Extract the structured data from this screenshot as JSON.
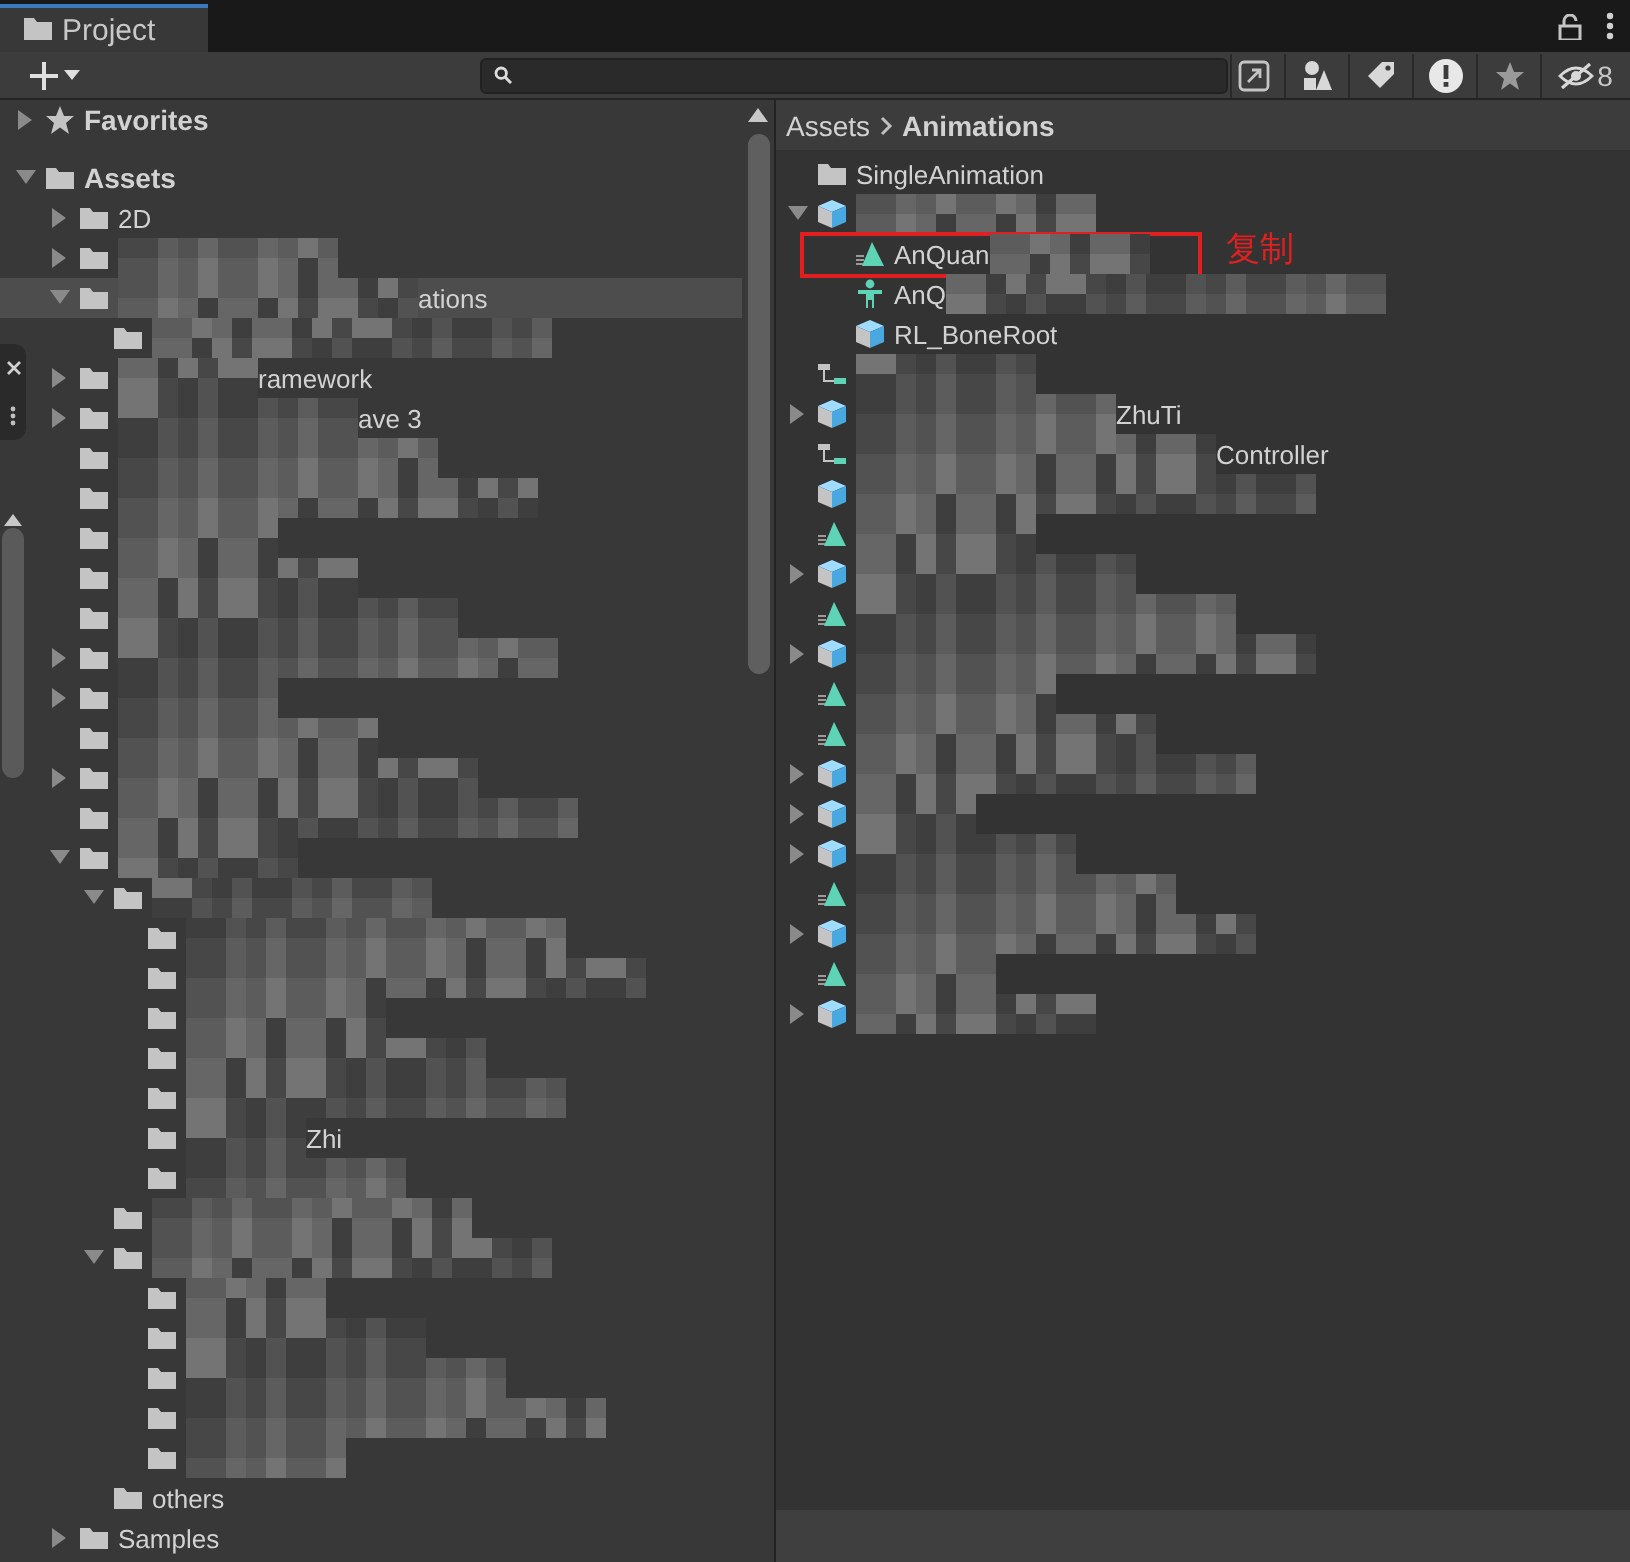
{
  "window": {
    "tab": "Project"
  },
  "toolbar": {
    "hidden_count": "8"
  },
  "tree": {
    "items": [
      {
        "kind": "star",
        "label": "Favorites",
        "expanded": false,
        "selected": false
      },
      {
        "kind": "folder",
        "label": "Assets",
        "expanded": true,
        "selected": false,
        "children": [
          {
            "kind": "folder",
            "label": "2D",
            "expanded": false,
            "selected": false
          },
          {
            "kind": "folder",
            "blurred_before": true,
            "expanded": false,
            "selected": false
          },
          {
            "kind": "folder",
            "label": "ations",
            "blurred_before": true,
            "expanded": true,
            "selected": true,
            "children": [
              {
                "kind": "folder",
                "blurred_before": true,
                "selected": false
              }
            ]
          },
          {
            "kind": "folder",
            "label": "ramework",
            "blurred_before": true,
            "expanded": false,
            "selected": false
          },
          {
            "kind": "folder",
            "label": "ave 3",
            "blurred_before": true,
            "expanded": false,
            "selected": false
          },
          {
            "kind": "folder",
            "blurred_before": true,
            "selected": false
          },
          {
            "kind": "folder",
            "blurred_before": true,
            "selected": false
          },
          {
            "kind": "folder",
            "blurred_before": true,
            "selected": false
          },
          {
            "kind": "folder",
            "blurred_before": true,
            "selected": false
          },
          {
            "kind": "folder",
            "blurred_before": true,
            "selected": false
          },
          {
            "kind": "folder",
            "blurred_before": true,
            "expanded": false,
            "selected": false
          },
          {
            "kind": "folder",
            "blurred_before": true,
            "expanded": false,
            "selected": false
          },
          {
            "kind": "folder",
            "blurred_before": true,
            "selected": false
          },
          {
            "kind": "folder",
            "blurred_before": true,
            "expanded": false,
            "selected": false
          },
          {
            "kind": "folder",
            "blurred_before": true,
            "selected": false
          },
          {
            "kind": "folder",
            "blurred_before": true,
            "expanded": true,
            "selected": false,
            "children": [
              {
                "kind": "folder",
                "blurred_before": true,
                "expanded": true,
                "selected": false,
                "children": [
                  {
                    "kind": "folder",
                    "blurred_before": true,
                    "selected": false
                  },
                  {
                    "kind": "folder",
                    "blurred_before": true,
                    "selected": false
                  },
                  {
                    "kind": "folder",
                    "blurred_before": true,
                    "selected": false
                  },
                  {
                    "kind": "folder",
                    "blurred_before": true,
                    "selected": false
                  },
                  {
                    "kind": "folder",
                    "blurred_before": true,
                    "selected": false
                  },
                  {
                    "kind": "folder",
                    "label": "Zhi",
                    "blurred_before": true,
                    "selected": false
                  },
                  {
                    "kind": "folder",
                    "blurred_before": true,
                    "selected": false
                  }
                ]
              },
              {
                "kind": "folder",
                "blurred_before": true,
                "selected": false
              },
              {
                "kind": "folder",
                "blurred_before": true,
                "expanded": true,
                "selected": false,
                "children": [
                  {
                    "kind": "folder",
                    "blurred_before": true,
                    "selected": false
                  },
                  {
                    "kind": "folder",
                    "blurred_before": true,
                    "selected": false
                  },
                  {
                    "kind": "folder",
                    "blurred_before": true,
                    "selected": false
                  },
                  {
                    "kind": "folder",
                    "blurred_before": true,
                    "selected": false
                  },
                  {
                    "kind": "folder",
                    "blurred_before": true,
                    "selected": false
                  }
                ]
              },
              {
                "kind": "folder",
                "label": "others",
                "selected": false
              }
            ]
          },
          {
            "kind": "folder",
            "label": "Samples",
            "expanded": false,
            "selected": false
          }
        ]
      }
    ]
  },
  "breadcrumb": [
    {
      "label": "Assets",
      "current": false
    },
    {
      "label": "Animations",
      "current": true
    }
  ],
  "assets": {
    "items": [
      {
        "kind": "folder",
        "label": "SingleAnimation"
      },
      {
        "kind": "prefab",
        "blurred_before": true,
        "expanded": true,
        "children": [
          {
            "kind": "clip",
            "label": "AnQuan",
            "blurred_after": true,
            "highlighted": true
          },
          {
            "kind": "avatar",
            "label": "AnQ",
            "blurred_after": true,
            "highlighted": false
          },
          {
            "kind": "prefab",
            "label": "RL_BoneRoot",
            "highlighted": false
          }
        ]
      },
      {
        "kind": "controller",
        "blurred_before": true
      },
      {
        "kind": "prefab",
        "label": "ZhuTi",
        "blurred_before": true,
        "expanded": false
      },
      {
        "kind": "controller",
        "label": "Controller",
        "blurred_before": true
      },
      {
        "kind": "prefab",
        "blurred_before": true
      },
      {
        "kind": "clip",
        "blurred_before": true
      },
      {
        "kind": "prefab",
        "blurred_before": true,
        "expanded": false
      },
      {
        "kind": "clip",
        "blurred_before": true
      },
      {
        "kind": "prefab",
        "blurred_before": true,
        "expanded": false
      },
      {
        "kind": "clip",
        "blurred_before": true
      },
      {
        "kind": "clip",
        "blurred_before": true
      },
      {
        "kind": "prefab",
        "blurred_before": true,
        "expanded": false
      },
      {
        "kind": "prefab",
        "blurred_before": true,
        "expanded": false
      },
      {
        "kind": "prefab",
        "blurred_before": true,
        "expanded": false
      },
      {
        "kind": "clip",
        "blurred_before": true
      },
      {
        "kind": "prefab",
        "blurred_before": true,
        "expanded": false
      },
      {
        "kind": "clip",
        "blurred_before": true
      },
      {
        "kind": "prefab",
        "blurred_before": true,
        "expanded": false
      }
    ]
  },
  "annotation": {
    "text": "复制"
  }
}
